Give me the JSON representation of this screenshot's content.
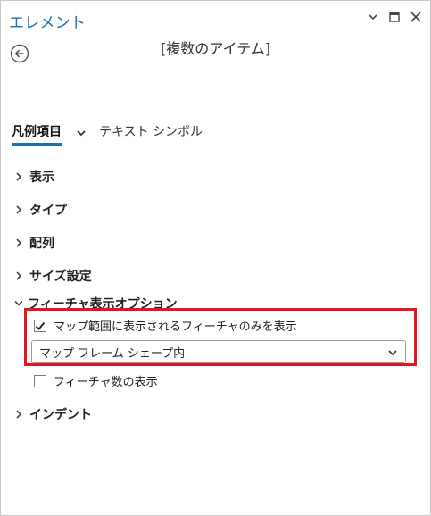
{
  "panel": {
    "title": "エレメント",
    "item_name": "[複数のアイテム]"
  },
  "tabs": [
    {
      "label": "凡例項目",
      "active": true
    },
    {
      "label": "テキスト シンボル",
      "active": false
    }
  ],
  "sections": [
    {
      "label": "表示",
      "expanded": false
    },
    {
      "label": "タイプ",
      "expanded": false
    },
    {
      "label": "配列",
      "expanded": false
    },
    {
      "label": "サイズ設定",
      "expanded": false
    }
  ],
  "feature_options": {
    "label": "フィーチャ表示オプション",
    "expanded": true,
    "visible_only_checkbox": {
      "label": "マップ範囲に表示されるフィーチャのみを表示",
      "checked": true
    },
    "extent_dropdown": {
      "selected": "マップ フレーム シェープ内"
    },
    "feature_count_checkbox": {
      "label": "フィーチャ数の表示",
      "checked": false
    }
  },
  "indent_section": {
    "label": "インデント",
    "expanded": false
  },
  "colors": {
    "accent": "#1b6fb5",
    "highlight": "#e5141e"
  }
}
